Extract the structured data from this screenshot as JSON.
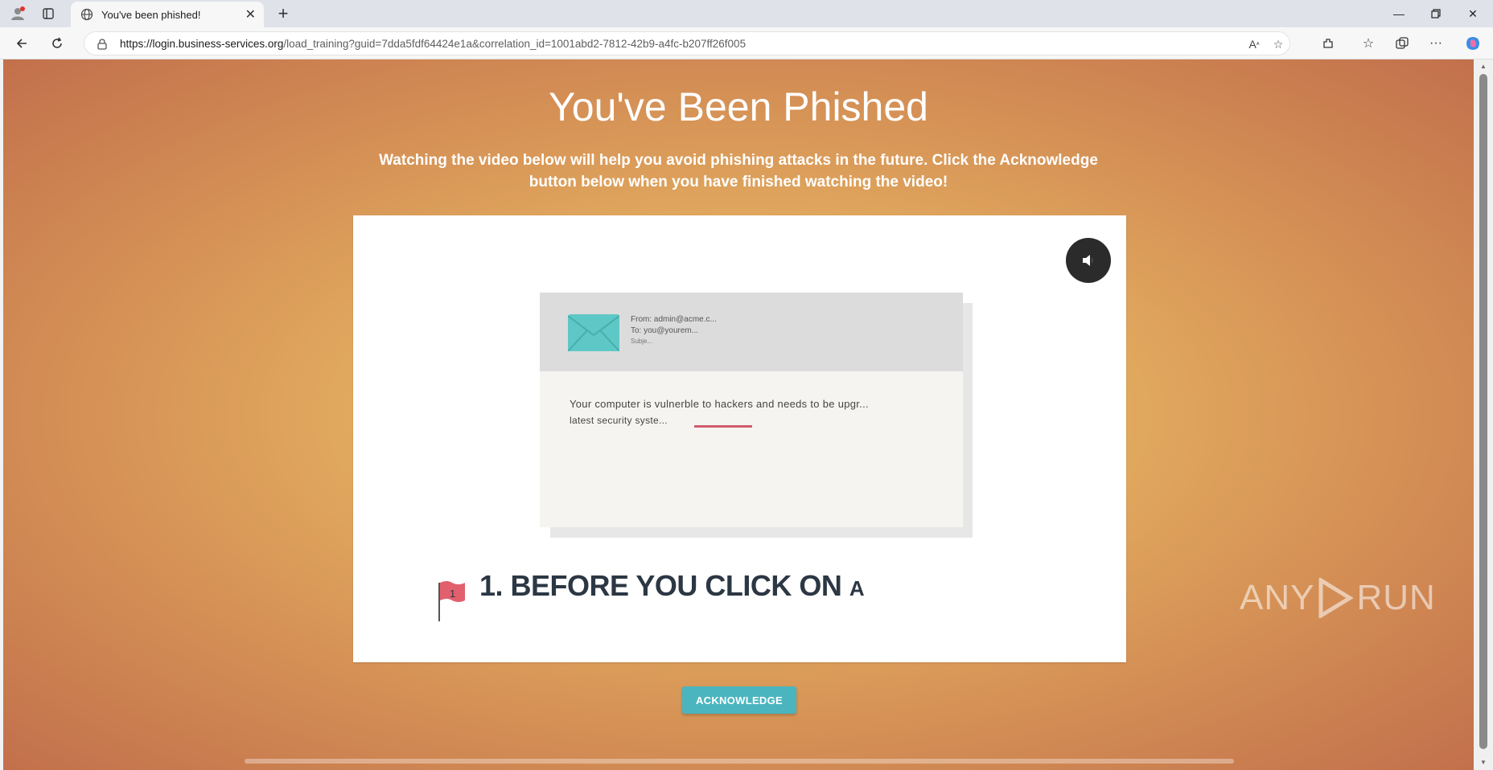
{
  "browser": {
    "tab_title": "You've been phished!",
    "url_host": "https://login.business-services.org",
    "url_path": "/load_training?guid=7dda5fdf64424e1a&correlation_id=1001abd2-7812-42b9-a4fc-b207ff26f005"
  },
  "page": {
    "title": "You've Been Phished",
    "subtitle_line1": "Watching the video below will help you avoid phishing attacks in the future. Click the Acknowledge",
    "subtitle_line2": "button below when you have finished watching the video!",
    "acknowledge_label": "ACKNOWLEDGE"
  },
  "video": {
    "email_from": "From: admin@acme.c...",
    "email_to": "To: you@yourem...",
    "email_subject": "Subje...",
    "email_body_line1": "Your computer is vulnerble to hackers and needs to be upgr...",
    "email_body_line2": "latest security syste...",
    "flag_number": "1",
    "heading": "1. BEFORE YOU CLICK ON",
    "heading_tail": "A"
  },
  "watermark": {
    "left": "ANY",
    "right": "RUN"
  },
  "colors": {
    "accent": "#4ab5be",
    "bg_center": "#e9b866",
    "bg_edge": "#c2704c"
  }
}
